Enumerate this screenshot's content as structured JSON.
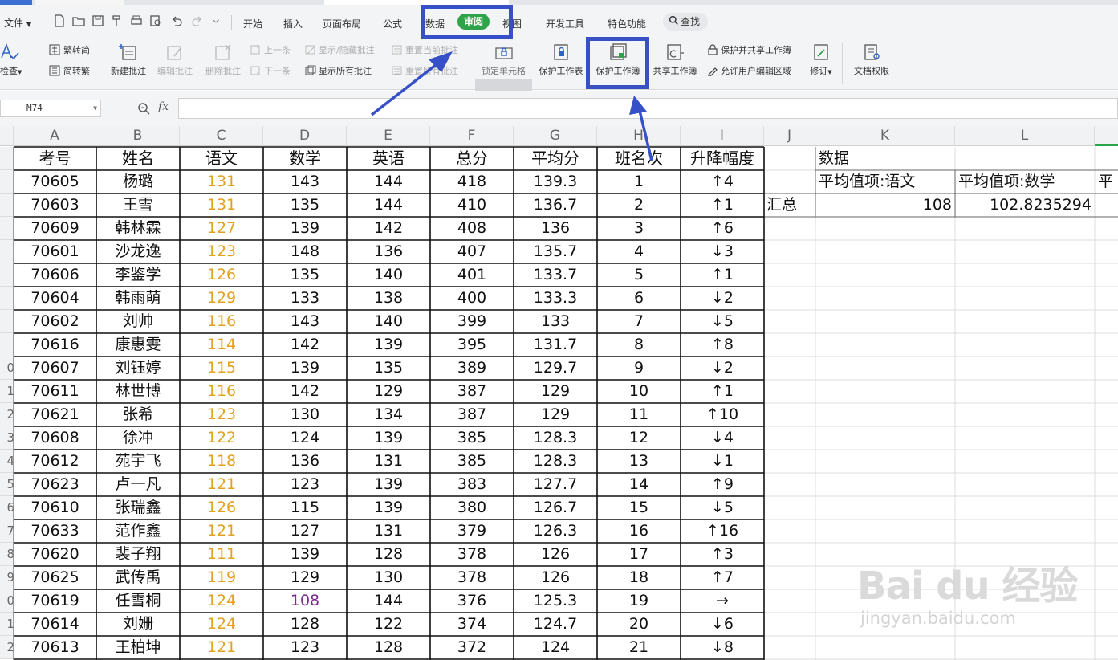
{
  "menu": {
    "file_label": "文件",
    "tabs": [
      "开始",
      "插入",
      "页面布局",
      "公式",
      "数据",
      "审阅",
      "视图",
      "开发工具",
      "特色功能"
    ],
    "active_tab": "审阅",
    "find_label": "查找"
  },
  "ribbon": {
    "check": "检查",
    "trad_to_simp": "繁转简",
    "simp_to_trad": "简转繁",
    "new_comment": "新建批注",
    "edit_comment": "编辑批注",
    "delete_comment": "删除批注",
    "prev": "上一条",
    "next": "下一条",
    "show_hide_comment": "显示/隐藏批注",
    "show_all_comments": "显示所有批注",
    "reset_current_comment": "重置当前批注",
    "reset_all_comments": "重置所有批注",
    "lock_cell": "锁定单元格",
    "protect_sheet": "保护工作表",
    "protect_workbook": "保护工作簿",
    "share_workbook": "共享工作簿",
    "protect_share_workbook": "保护并共享工作簿",
    "allow_edit_ranges": "允许用户编辑区域",
    "track_changes": "修订",
    "doc_permissions": "文档权限"
  },
  "formula_bar": {
    "name_box": "M74",
    "fx": "fx",
    "value": ""
  },
  "columns": [
    "A",
    "B",
    "C",
    "D",
    "E",
    "F",
    "G",
    "H",
    "I",
    "J",
    "K",
    "L"
  ],
  "row_numbers": [
    "",
    "",
    "",
    "",
    "",
    "",
    "",
    "",
    "",
    "0",
    "1",
    "2",
    "3",
    "4",
    "5",
    "6",
    "7",
    "8",
    "9",
    "0",
    "1",
    "2"
  ],
  "table": {
    "headers": [
      "考号",
      "姓名",
      "语文",
      "数学",
      "英语",
      "总分",
      "平均分",
      "班名次",
      "升降幅度"
    ],
    "rows": [
      [
        "70605",
        "杨璐",
        "131",
        "143",
        "144",
        "418",
        "139.3",
        "1",
        "↑4"
      ],
      [
        "70603",
        "王雪",
        "131",
        "135",
        "144",
        "410",
        "136.7",
        "2",
        "↑1"
      ],
      [
        "70609",
        "韩林霖",
        "127",
        "139",
        "142",
        "408",
        "136",
        "3",
        "↑6"
      ],
      [
        "70601",
        "沙龙逸",
        "123",
        "148",
        "136",
        "407",
        "135.7",
        "4",
        "↓3"
      ],
      [
        "70606",
        "李鉴学",
        "126",
        "135",
        "140",
        "401",
        "133.7",
        "5",
        "↑1"
      ],
      [
        "70604",
        "韩雨萌",
        "129",
        "133",
        "138",
        "400",
        "133.3",
        "6",
        "↓2"
      ],
      [
        "70602",
        "刘帅",
        "116",
        "143",
        "140",
        "399",
        "133",
        "7",
        "↓5"
      ],
      [
        "70616",
        "康惠雯",
        "114",
        "142",
        "139",
        "395",
        "131.7",
        "8",
        "↑8"
      ],
      [
        "70607",
        "刘钰婷",
        "115",
        "139",
        "135",
        "389",
        "129.7",
        "9",
        "↓2"
      ],
      [
        "70611",
        "林世博",
        "116",
        "142",
        "129",
        "387",
        "129",
        "10",
        "↑1"
      ],
      [
        "70621",
        "张希",
        "123",
        "130",
        "134",
        "387",
        "129",
        "11",
        "↑10"
      ],
      [
        "70608",
        "徐冲",
        "122",
        "124",
        "139",
        "385",
        "128.3",
        "12",
        "↓4"
      ],
      [
        "70612",
        "苑宇飞",
        "118",
        "136",
        "131",
        "385",
        "128.3",
        "13",
        "↓1"
      ],
      [
        "70623",
        "卢一凡",
        "121",
        "123",
        "139",
        "383",
        "127.7",
        "14",
        "↑9"
      ],
      [
        "70610",
        "张瑞鑫",
        "126",
        "115",
        "139",
        "380",
        "126.7",
        "15",
        "↓5"
      ],
      [
        "70633",
        "范作鑫",
        "121",
        "127",
        "131",
        "379",
        "126.3",
        "16",
        "↑16"
      ],
      [
        "70620",
        "裴子翔",
        "111",
        "139",
        "128",
        "378",
        "126",
        "17",
        "↑3"
      ],
      [
        "70625",
        "武传禹",
        "119",
        "129",
        "130",
        "378",
        "126",
        "18",
        "↑7"
      ],
      [
        "70619",
        "任雪桐",
        "124",
        "108",
        "144",
        "376",
        "125.3",
        "19",
        "→"
      ],
      [
        "70614",
        "刘姗",
        "124",
        "128",
        "122",
        "374",
        "124.7",
        "20",
        "↓6"
      ],
      [
        "70613",
        "王柏坤",
        "121",
        "123",
        "128",
        "372",
        "124",
        "21",
        "↓8"
      ]
    ],
    "purple_cell": {
      "row": 18,
      "col": 3
    }
  },
  "pivot": {
    "data_label": "数据",
    "col_k_header": "平均值项:语文",
    "col_l_header": "平均值项:数学",
    "col_m_header_partial": "平",
    "total_label": "汇总",
    "avg_chinese": "108",
    "avg_math": "102.8235294"
  },
  "watermark": {
    "brand": "Bai du 经验",
    "site": "jingyan.baidu.com"
  },
  "colors": {
    "active_tab": "#2fa34a",
    "highlight": "#3651c8",
    "chinese_score": "#e3a11e",
    "purple_score": "#7a2a8a"
  }
}
